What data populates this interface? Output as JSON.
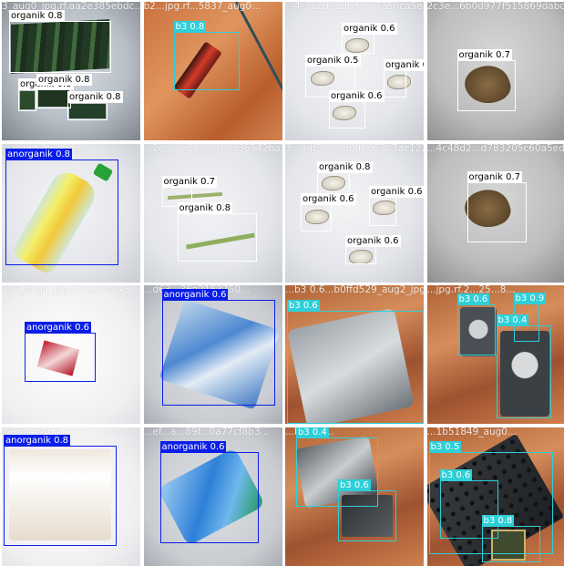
{
  "tiles": [
    {
      "name": "3_aug0_jpg.rf.aa2e385ebdc...",
      "boxes": [
        {
          "label": "organik 0.8",
          "kind": "organik"
        },
        {
          "label": "organik 0.8",
          "kind": "organik"
        },
        {
          "label": "organik 0.8",
          "kind": "organik"
        },
        {
          "label": "organik 0.8",
          "kind": "organik"
        }
      ]
    },
    {
      "name": "b2...jpg.rf...5837_aug0...",
      "boxes": [
        {
          "label": "b3 0.8",
          "kind": "b3"
        }
      ]
    },
    {
      "name": "...4c5c2de2dbd9f37250ca5e3...",
      "boxes": [
        {
          "label": "organik 0.6",
          "kind": "organik"
        },
        {
          "label": "organik 0.5",
          "kind": "organik"
        },
        {
          "label": "organik 0.6",
          "kind": "organik"
        },
        {
          "label": "organik 0.6",
          "kind": "organik"
        }
      ]
    },
    {
      "name": "2c3e...6b0d977f515869dabc",
      "boxes": [
        {
          "label": "organik 0.7",
          "kind": "organik"
        }
      ]
    },
    {
      "name": "...anorganik 0.8...",
      "boxes": [
        {
          "label": "anorganik 0.8",
          "kind": "anorganik"
        }
      ]
    },
    {
      "name": "...2e_aug2_jpg.rf.0335542ba3...",
      "boxes": [
        {
          "label": "organik 0.7",
          "kind": "organik"
        },
        {
          "label": "organik 0.8",
          "kind": "organik"
        }
      ]
    },
    {
      "name": "3...adf5...aug0.rf.023b7ac122...",
      "boxes": [
        {
          "label": "organik 0.8",
          "kind": "organik"
        },
        {
          "label": "organik 0.6",
          "kind": "organik"
        },
        {
          "label": "organik 0.6",
          "kind": "organik"
        },
        {
          "label": "organik 0.6",
          "kind": "organik"
        }
      ]
    },
    {
      "name": "...4c48d2...d783205c60a5ed9",
      "boxes": [
        {
          "label": "organik 0.7",
          "kind": "organik"
        }
      ]
    },
    {
      "name": "316_aug4_jpg.rf.7837e8781...",
      "boxes": [
        {
          "label": "anorganik 0.6",
          "kind": "anorganik"
        }
      ]
    },
    {
      "name": "...d63...36a2153750...",
      "boxes": [
        {
          "label": "anorganik 0.6",
          "kind": "anorganik"
        }
      ]
    },
    {
      "name": "...b3 0.6...b0ffd529_aug2_jpg...",
      "boxes": [
        {
          "label": "b3 0.6",
          "kind": "b3"
        }
      ]
    },
    {
      "name": "...jpg.rf.2...25...8...",
      "boxes": [
        {
          "label": "b3 0.6",
          "kind": "b3"
        },
        {
          "label": "b3 0.9",
          "kind": "b3"
        },
        {
          "label": "b3 0.4",
          "kind": "b3"
        }
      ]
    },
    {
      "name": "...93048d63...",
      "boxes": [
        {
          "label": "anorganik 0.8",
          "kind": "anorganik"
        }
      ]
    },
    {
      "name": "...ef...a...89f...0a77cf8b3...",
      "boxes": [
        {
          "label": "anorganik 0.6",
          "kind": "anorganik"
        }
      ]
    },
    {
      "name": "...b3 0.4...",
      "boxes": [
        {
          "label": "b3 0.4",
          "kind": "b3"
        },
        {
          "label": "b3 0.6",
          "kind": "b3"
        }
      ]
    },
    {
      "name": "...1b51849_aug0...",
      "boxes": [
        {
          "label": "b3 0.5",
          "kind": "b3"
        },
        {
          "label": "b3 0.6",
          "kind": "b3"
        },
        {
          "label": "b3 0.8",
          "kind": "b3"
        }
      ]
    }
  ],
  "colors": {
    "organik": "#ffffff",
    "b3": "#2ecfd8",
    "anorganik": "#0a1ee8"
  },
  "icons": {
    "battery": "battery-icon",
    "bottle": "plastic-bottle-icon",
    "leaf": "leaf-icon",
    "peel": "garlic-peel-icon",
    "chip": "electronic-chip-icon",
    "hdd": "hard-drive-icon"
  }
}
